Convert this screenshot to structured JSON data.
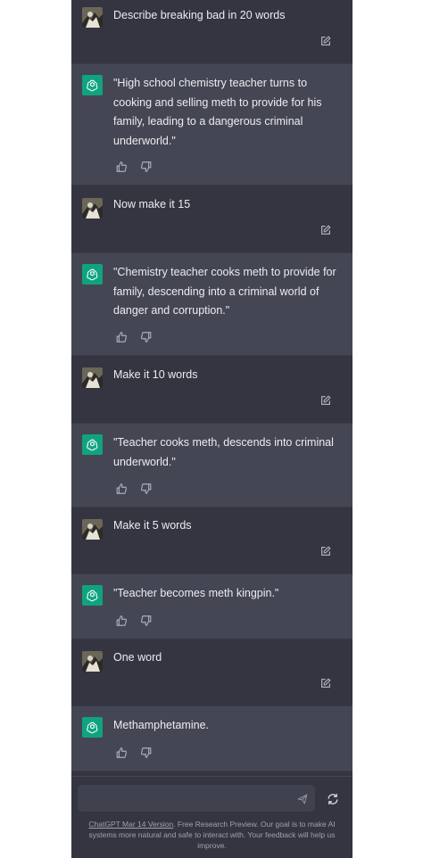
{
  "conversation": [
    {
      "role": "user",
      "text": "Describe breaking bad in 20 words"
    },
    {
      "role": "assistant",
      "text": "\"High school chemistry teacher turns to cooking and selling meth to provide for his family, leading to a dangerous criminal underworld.\""
    },
    {
      "role": "user",
      "text": "Now make it 15"
    },
    {
      "role": "assistant",
      "text": "\"Chemistry teacher cooks meth to provide for family, descending into a criminal world of danger and corruption.\""
    },
    {
      "role": "user",
      "text": "Make it 10 words"
    },
    {
      "role": "assistant",
      "text": "\"Teacher cooks meth, descends into criminal underworld.\""
    },
    {
      "role": "user",
      "text": "Make it 5 words"
    },
    {
      "role": "assistant",
      "text": "\"Teacher becomes meth kingpin.\""
    },
    {
      "role": "user",
      "text": "One word"
    },
    {
      "role": "assistant",
      "text": "Methamphetamine."
    }
  ],
  "composer": {
    "value": "",
    "send_icon": "send-icon",
    "regenerate_icon": "refresh-icon"
  },
  "footer": {
    "link_text": "ChatGPT Mar 14 Version",
    "text": ". Free Research Preview. Our goal is to make AI systems more natural and safe to interact with. Your feedback will help us improve."
  },
  "colors": {
    "background": "#343541",
    "assistant_background": "#444654",
    "gpt_green": "#10a37f",
    "text": "#ececf1",
    "icon": "#acacbe"
  }
}
